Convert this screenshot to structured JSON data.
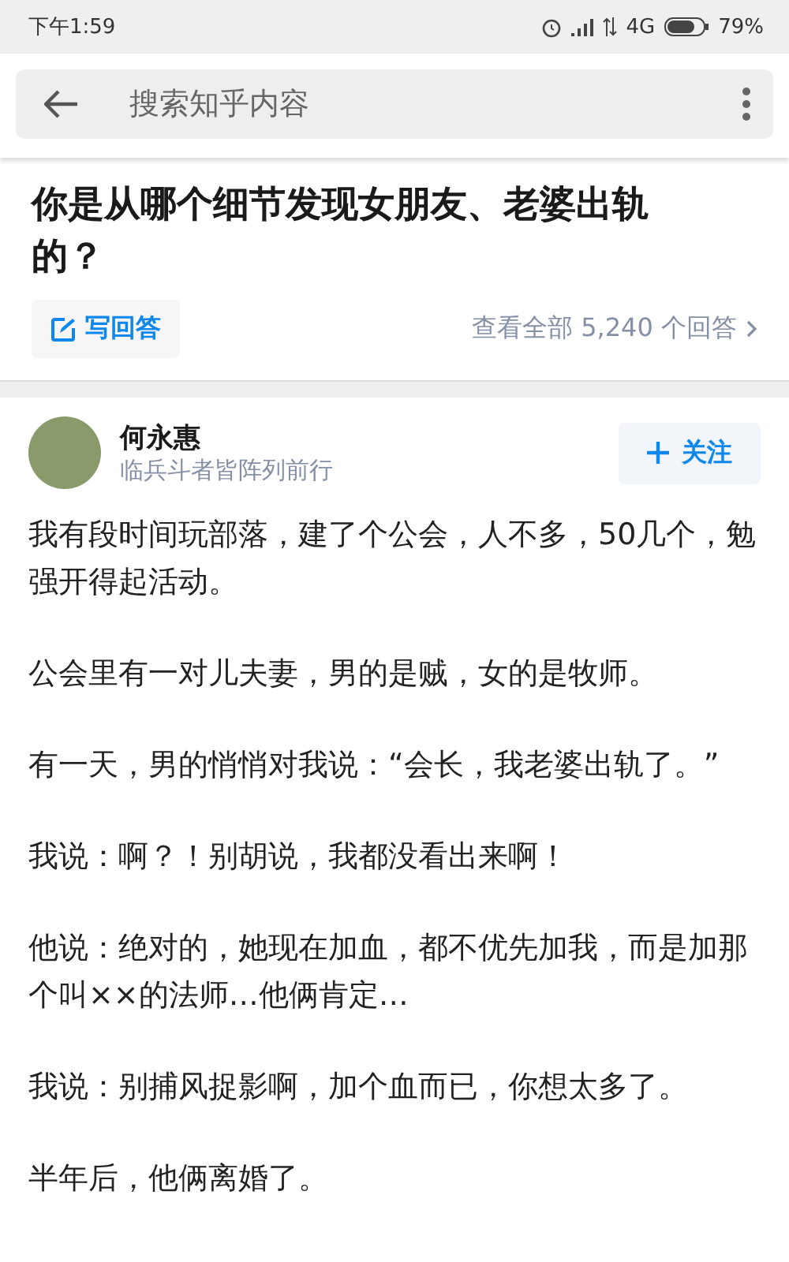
{
  "status_bar": {
    "time": "下午1:59",
    "network": "4G",
    "battery": "79%"
  },
  "search": {
    "placeholder": "搜索知乎内容"
  },
  "question": {
    "title": "你是从哪个细节发现女朋友、老婆出轨的？",
    "write_answer": "写回答",
    "view_all": "查看全部 5,240 个回答"
  },
  "author": {
    "name": "何永惠",
    "bio": "临兵斗者皆阵列前行",
    "follow": "关注"
  },
  "paragraphs": [
    "我有段时间玩部落，建了个公会，人不多，50几个，勉强开得起活动。",
    "公会里有一对儿夫妻，男的是贼，女的是牧师。",
    "有一天，男的悄悄对我说：“会长，我老婆出轨了。”",
    "我说：啊？！别胡说，我都没看出来啊！",
    "他说：绝对的，她现在加血，都不优先加我，而是加那个叫××的法师…他俩肯定…",
    "我说：别捕风捉影啊，加个血而已，你想太多了。",
    "半年后，他俩离婚了。"
  ]
}
